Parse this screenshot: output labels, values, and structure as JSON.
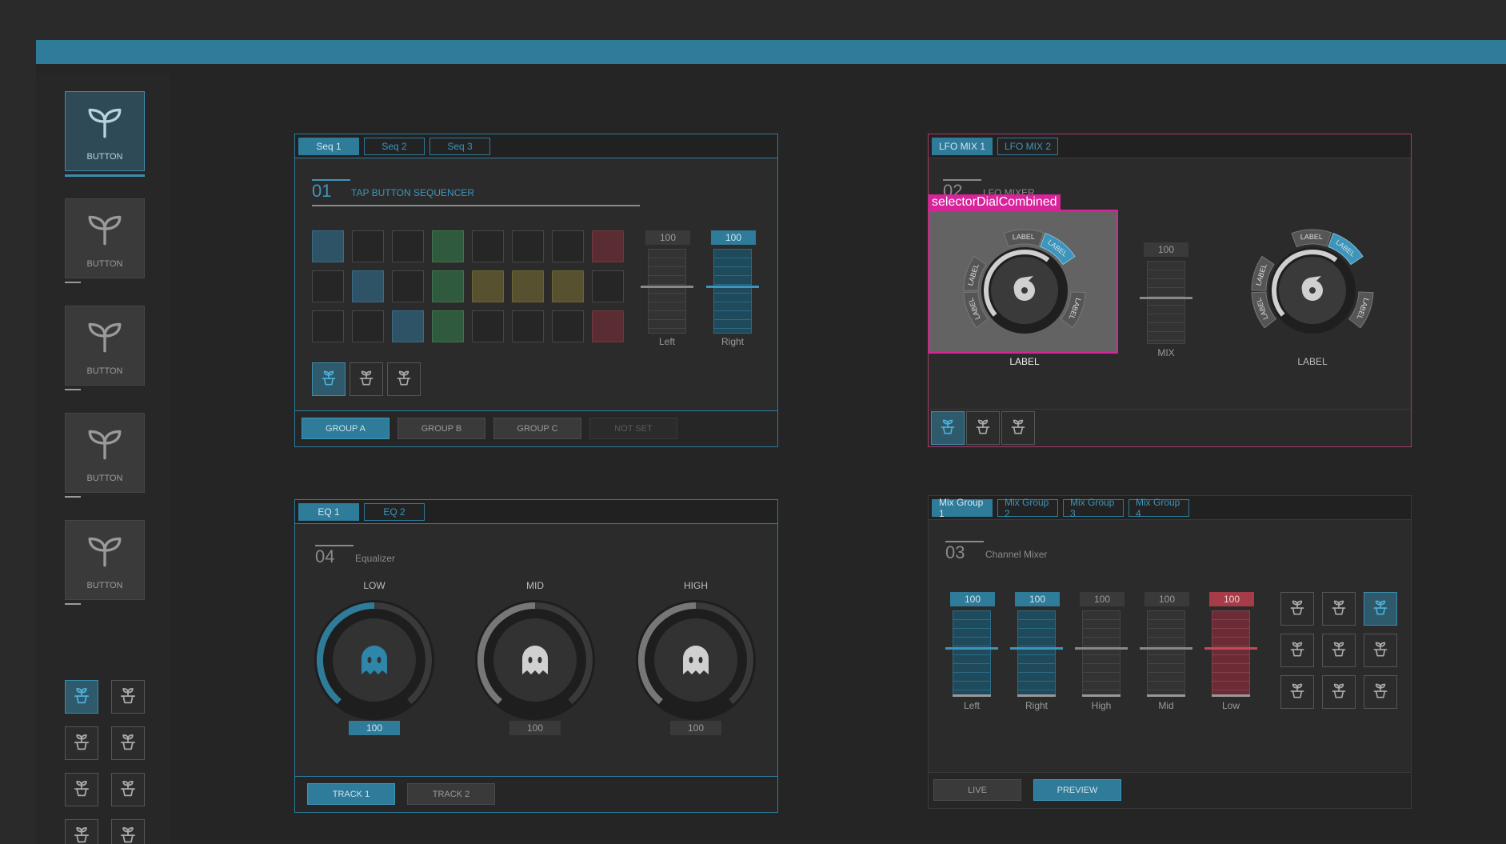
{
  "colors": {
    "accent": "#2e7b9a",
    "highlight": "#d8239a",
    "green": "#2f5a3d",
    "yellow": "#57512f",
    "red": "#a63c48"
  },
  "sidebar": {
    "buttons": [
      {
        "label": "BUTTON",
        "active": true,
        "icon": "plant-icon"
      },
      {
        "label": "BUTTON",
        "active": false,
        "icon": "plant-icon"
      },
      {
        "label": "BUTTON",
        "active": false,
        "icon": "plant-icon"
      },
      {
        "label": "BUTTON",
        "active": false,
        "icon": "plant-icon"
      },
      {
        "label": "BUTTON",
        "active": false,
        "icon": "plant-icon"
      }
    ],
    "small_grid_active_index": 0
  },
  "seq_panel": {
    "tabs": [
      "Seq 1",
      "Seq 2",
      "Seq 3"
    ],
    "active_tab": 0,
    "number": "01",
    "title": "TAP BUTTON SEQUENCER",
    "grid": [
      [
        "blue",
        "",
        "",
        "green",
        "",
        "",
        "",
        "red"
      ],
      [
        "",
        "blue",
        "",
        "green",
        "yellow",
        "yellow",
        "yellow",
        ""
      ],
      [
        "",
        "",
        "blue",
        "green",
        "",
        "",
        "",
        "red"
      ]
    ],
    "faders": [
      {
        "label": "Left",
        "value": "100",
        "active": false
      },
      {
        "label": "Right",
        "value": "100",
        "active": true
      }
    ],
    "pots_active_index": 0,
    "footer": [
      "GROUP A",
      "GROUP B",
      "GROUP C",
      "NOT SET"
    ]
  },
  "lfo_panel": {
    "tabs": [
      "LFO MIX 1",
      "LFO MIX 2"
    ],
    "active_tab": 0,
    "number": "02",
    "title": "LFO MIXER",
    "highlight_tag": "selectorDialCombined",
    "dial_segment_labels": [
      "LABEL",
      "LABEL",
      "LABEL",
      "LABEL",
      "LABEL",
      "LABEL"
    ],
    "dial_left_label": "LABEL",
    "dial_right_label": "LABEL",
    "mix_value": "100",
    "mix_label": "MIX",
    "pots_active_index": 0
  },
  "eq_panel": {
    "tabs": [
      "EQ 1",
      "EQ 2"
    ],
    "active_tab": 0,
    "number": "04",
    "title": "Equalizer",
    "knobs": [
      {
        "label": "LOW",
        "value": "100",
        "active": true
      },
      {
        "label": "MID",
        "value": "100",
        "active": false
      },
      {
        "label": "HIGH",
        "value": "100",
        "active": false
      }
    ],
    "footer": [
      "TRACK 1",
      "TRACK 2"
    ]
  },
  "mix_panel": {
    "tabs": [
      "Mix Group 1",
      "Mix Group 2",
      "Mix Group 3",
      "Mix Group 4"
    ],
    "active_tab": 0,
    "number": "03",
    "title": "Channel Mixer",
    "faders": [
      {
        "label": "Left",
        "value": "100",
        "style": "blue"
      },
      {
        "label": "Right",
        "value": "100",
        "style": "blue"
      },
      {
        "label": "High",
        "value": "100",
        "style": ""
      },
      {
        "label": "Mid",
        "value": "100",
        "style": ""
      },
      {
        "label": "Low",
        "value": "100",
        "style": "red"
      }
    ],
    "pot_grid_active_index": 2,
    "footer": [
      "LIVE",
      "PREVIEW"
    ],
    "footer_active": 1
  }
}
